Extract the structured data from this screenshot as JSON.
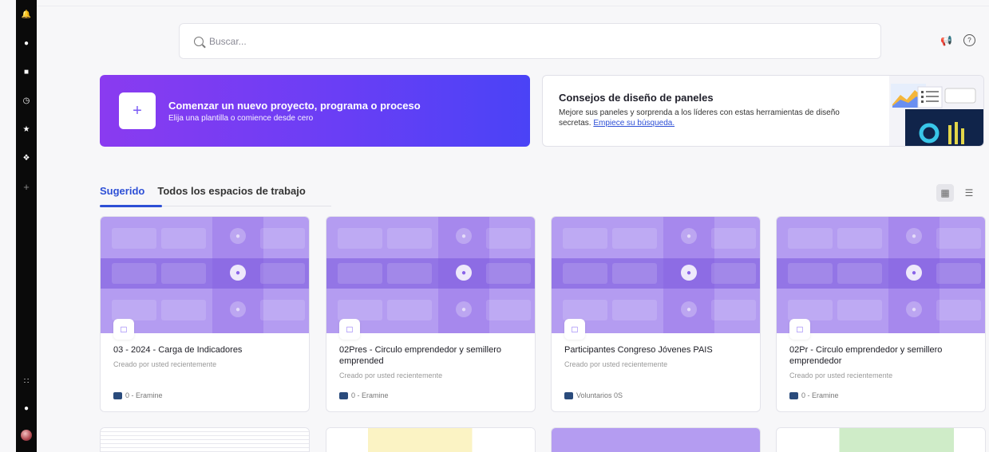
{
  "search": {
    "placeholder": "Buscar..."
  },
  "banner_new": {
    "title": "Comenzar un nuevo proyecto, programa o proceso",
    "subtitle": "Elija una plantilla o comience desde cero"
  },
  "banner_tips": {
    "title": "Consejos de diseño de paneles",
    "body": "Mejore sus paneles y sorprenda a los líderes con estas herramientas de diseño secretas.",
    "link": "Empiece su búsqueda."
  },
  "tabs": [
    {
      "label": "Sugerido"
    },
    {
      "label": "Todos los espacios de trabajo"
    }
  ],
  "cards": [
    {
      "title": "03 - 2024 - Carga de Indicadores",
      "subtitle": "Creado por usted recientemente",
      "workspace": "0 - Eramine"
    },
    {
      "title": "02Pres - Circulo emprendedor y semillero emprended",
      "subtitle": "Creado por usted recientemente",
      "workspace": "0 - Eramine"
    },
    {
      "title": "Participantes Congreso Jóvenes PAIS",
      "subtitle": "Creado por usted recientemente",
      "workspace": "Voluntarios 0S"
    },
    {
      "title": "02Pr - Circulo emprendedor y semillero emprendedor",
      "subtitle": "Creado por usted recientemente",
      "workspace": "0 - Eramine"
    }
  ],
  "colors": {
    "accent": "#2d4fd6",
    "banner_start": "#8a3bf0",
    "banner_end": "#4a43f6",
    "card_thumb": "#b49cf1"
  },
  "icons": {
    "rail": [
      "bell-icon",
      "search-icon",
      "folder-icon",
      "clock-icon",
      "star-icon",
      "apps-icon",
      "plus-icon"
    ],
    "rail_bottom": [
      "grid-icon",
      "help-icon",
      "avatar"
    ],
    "top": [
      "megaphone-icon",
      "help-icon"
    ]
  }
}
